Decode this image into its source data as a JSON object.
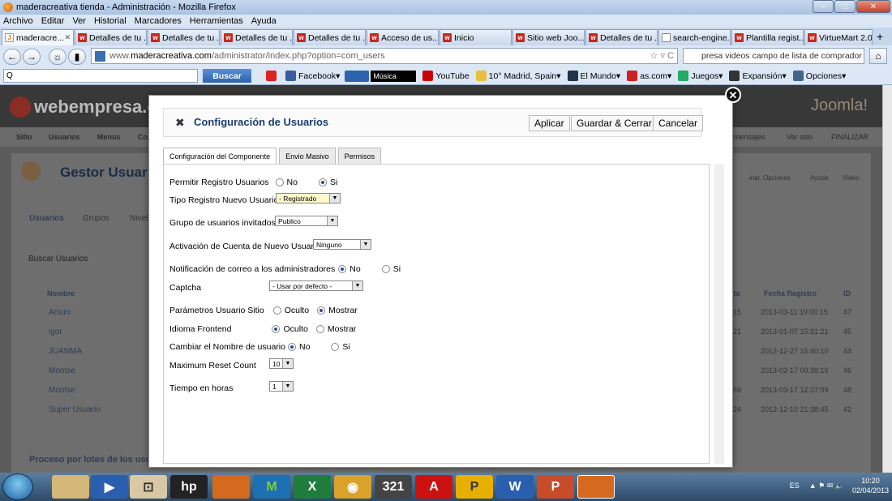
{
  "window": {
    "title": "maderacreativa tienda - Administración - Mozilla Firefox"
  },
  "menubar": [
    "Archivo",
    "Editar",
    "Ver",
    "Historial",
    "Marcadores",
    "Herramientas",
    "Ayuda"
  ],
  "tabs": [
    {
      "label": "maderacre...",
      "icon": "joomla-icon"
    },
    {
      "label": "Detalles de tu ...",
      "icon": "webempresa-icon"
    },
    {
      "label": "Detalles de tu ...",
      "icon": "webempresa-icon"
    },
    {
      "label": "Detalles de tu ...",
      "icon": "webempresa-icon"
    },
    {
      "label": "Detalles de tu ...",
      "icon": "webempresa-icon"
    },
    {
      "label": "Acceso de us...",
      "icon": "webempresa-icon"
    },
    {
      "label": "Inicio",
      "icon": "webempresa-icon"
    },
    {
      "label": "Sitio web Joo...",
      "icon": "webempresa-icon"
    },
    {
      "label": "Detalles de tu ...",
      "icon": "webempresa-icon"
    },
    {
      "label": "search-engine...",
      "icon": "page-icon"
    },
    {
      "label": "Plantilla regist...",
      "icon": "webempresa-icon"
    },
    {
      "label": "VirtueMart 2.0...",
      "icon": "webempresa-icon"
    }
  ],
  "nav": {
    "url_domain": "maderacreativa.com",
    "url_prefix": "www.",
    "url_path": "/administrator/index.php?option=com_users",
    "search_value": "presa videos campo de lista de comprador"
  },
  "toolbar2": {
    "search_placeholder": "Q",
    "buscar": "Buscar",
    "facebook": "Facebook",
    "musica": "Música",
    "youtube": "YouTube",
    "weather": "10° Madrid, Spain",
    "elmundo": "El Mundo",
    "as": "as.com",
    "juegos": "Juegos",
    "expansion": "Expansión",
    "opciones": "Opciones"
  },
  "background": {
    "logo": "webempresa.com",
    "joomla": "Joomla!",
    "menu": [
      "Sitio",
      "Usuarios",
      "Menús",
      "Co"
    ],
    "right_menu": [
      "mensajes",
      "Ver sitio",
      "FINALIZAR"
    ],
    "page_title": "Gestor Usuar",
    "subnav": [
      "Usuarios",
      "Grupos",
      "Nivel"
    ],
    "search_label": "Buscar Usuarios",
    "col_name": "Nombre",
    "col_date": "Fecha Registro",
    "col_id": "ID",
    "col_vis": "ita",
    "toolbar_icons": [
      "inar",
      "Opciones",
      "Ayuda",
      "Video"
    ],
    "rows": [
      {
        "name": "Arturo",
        "frag": "15",
        "date": "2013-03-11 19:00:15",
        "id": "47"
      },
      {
        "name": "igor",
        "frag": "21",
        "date": "2013-01-07 15:31:21",
        "id": "45"
      },
      {
        "name": "JUANMA",
        "frag": "",
        "date": "2012-12-27 15:40:10",
        "id": "44"
      },
      {
        "name": "Montse",
        "frag": "",
        "date": "2013-02-17 09:38:16",
        "id": "46"
      },
      {
        "name": "Montse",
        "frag": "59",
        "date": "2013-03-17 12:37:09",
        "id": "48"
      },
      {
        "name": "Super Usuario",
        "frag": "24",
        "date": "2012-12-10 21:38:45",
        "id": "42"
      }
    ],
    "batch": "Proceso por lotes de los usu"
  },
  "dialog": {
    "title": "Configuración de Usuarios",
    "buttons": {
      "apply": "Aplicar",
      "save_close": "Guardar & Cerrar",
      "cancel": "Cancelar"
    },
    "tabs": [
      "Configuración del Componente",
      "Envio Masivo",
      "Permisos"
    ],
    "fields": {
      "allow_reg": {
        "label": "Permitir Registro Usuarios",
        "opt_no": "No",
        "opt_si": "Si"
      },
      "reg_type": {
        "label": "Tipo Registro Nuevo Usuario",
        "value": "- Registrado"
      },
      "guest_group": {
        "label": "Grupo de usuarios invitados",
        "value": "Publico"
      },
      "activation": {
        "label": "Activación de Cuenta de Nuevo Usuario",
        "value": "Ninguno"
      },
      "notify_admins": {
        "label": "Notificación de correo a los administradores",
        "opt_no": "No",
        "opt_si": "Si"
      },
      "captcha": {
        "label": "Captcha",
        "value": "- Usar por defecto -"
      },
      "site_params": {
        "label": "Parámetros Usuario Sitio",
        "opt_a": "Oculto",
        "opt_b": "Mostrar"
      },
      "frontend_lang": {
        "label": "Idioma Frontend",
        "opt_a": "Oculto",
        "opt_b": "Mostrar"
      },
      "change_username": {
        "label": "Cambiar el Nombre de usuario",
        "opt_no": "No",
        "opt_si": "Si"
      },
      "max_reset": {
        "label": "Maximum Reset Count",
        "value": "10"
      },
      "time_hours": {
        "label": "Tiempo en horas",
        "value": "1"
      }
    }
  },
  "taskbar": {
    "lang": "ES",
    "time": "10:20",
    "date": "02/04/2013"
  }
}
